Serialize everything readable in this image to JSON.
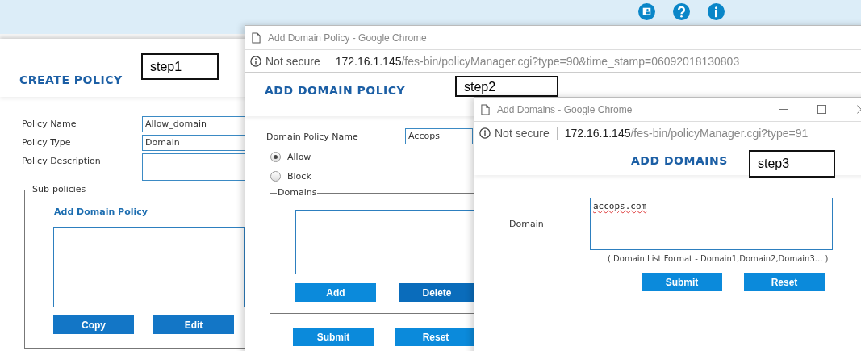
{
  "create_policy": {
    "title": "CREATE POLICY",
    "annotation": "step1",
    "fields": [
      {
        "label": "Policy Name",
        "value": "Allow_domain"
      },
      {
        "label": "Policy Type",
        "value": "Domain"
      },
      {
        "label": "Policy Description"
      }
    ],
    "sub_policies": {
      "legend": "Sub-policies",
      "link": "Add Domain Policy",
      "buttons": [
        "Copy",
        "Edit"
      ]
    }
  },
  "domain_policy_window": {
    "title": "Add Domain Policy - Google Chrome",
    "security": "Not secure",
    "url_host": "172.16.1.145",
    "url_path": "/fes-bin/policyManager.cgi?type=90&time_stamp=06092018130803",
    "heading": "ADD DOMAIN POLICY",
    "annotation": "step2",
    "name_label": "Domain Policy Name",
    "name_value": "Accops",
    "options": [
      {
        "label": "Allow",
        "selected": true
      },
      {
        "label": "Block",
        "selected": false
      }
    ],
    "domains": {
      "legend": "Domains",
      "buttons": [
        {
          "label": "Add",
          "highlighted": false
        },
        {
          "label": "Delete",
          "highlighted": true
        }
      ]
    },
    "buttons": [
      "Submit",
      "Reset"
    ]
  },
  "domains_window": {
    "title": "Add Domains - Google Chrome",
    "security": "Not secure",
    "url_host": "172.16.1.145",
    "url_path": "/fes-bin/policyManager.cgi?type=91",
    "heading": "ADD DOMAINS",
    "annotation": "step3",
    "domain_label": "Domain",
    "domain_value": "accops.com",
    "hint": "( Domain List Format - Domain1,Domain2,Domain3... )",
    "buttons": [
      "Submit",
      "Reset"
    ]
  }
}
